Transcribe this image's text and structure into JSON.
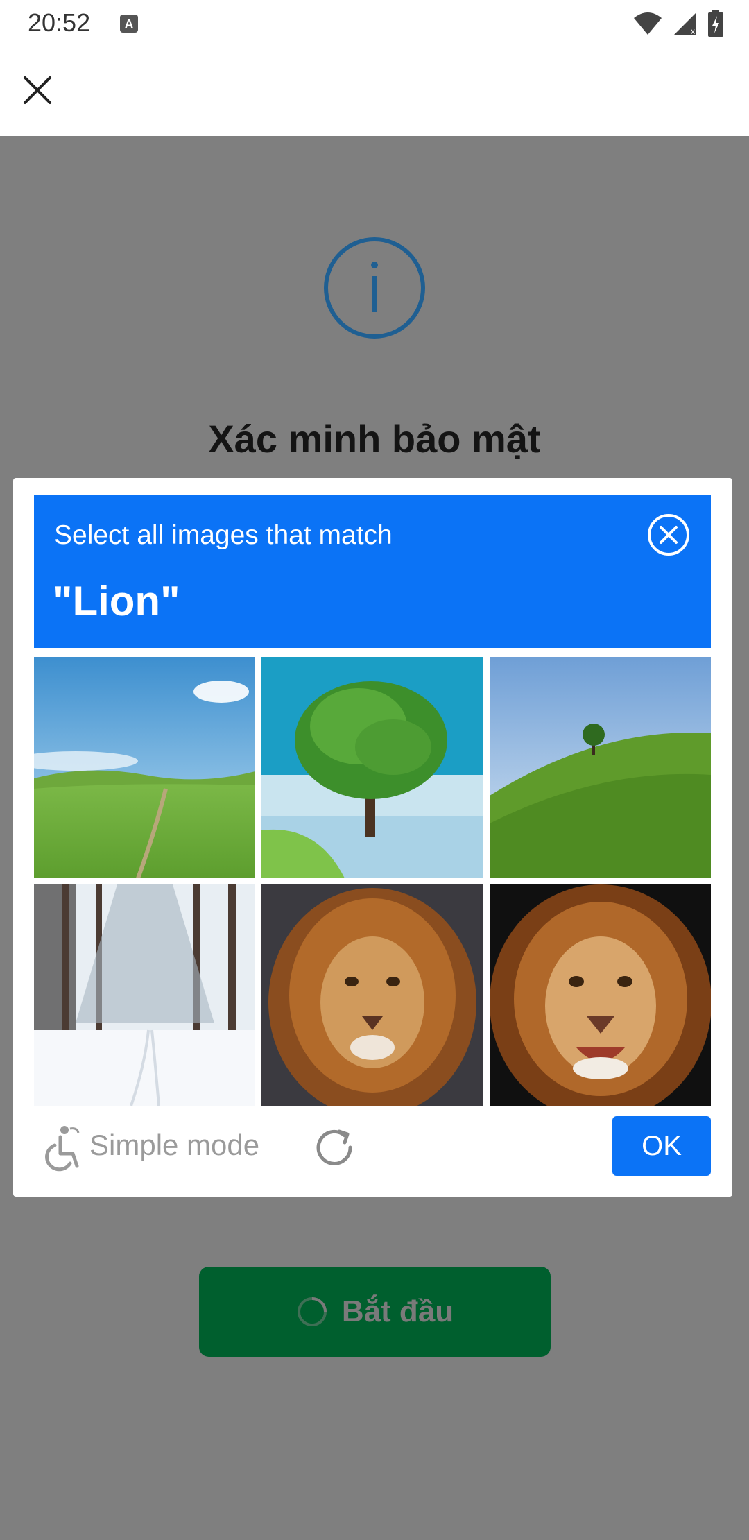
{
  "status_bar": {
    "time": "20:52"
  },
  "page": {
    "title": "Xác minh bảo mật",
    "start_button_label": "Bắt đầu"
  },
  "captcha": {
    "instruction": "Select all images that match",
    "target": "\"Lion\"",
    "simple_mode_label": "Simple mode",
    "ok_label": "OK",
    "accent_color": "#0b73f6",
    "tiles": [
      {
        "content": "grass field"
      },
      {
        "content": "tree by water"
      },
      {
        "content": "green hill with tree"
      },
      {
        "content": "snowy forest path"
      },
      {
        "content": "lion"
      },
      {
        "content": "lion"
      }
    ]
  },
  "icons": {
    "close": "close-icon",
    "info": "info-icon",
    "captcha_close": "circle-close-icon",
    "accessibility": "accessibility-icon",
    "refresh": "refresh-icon"
  }
}
